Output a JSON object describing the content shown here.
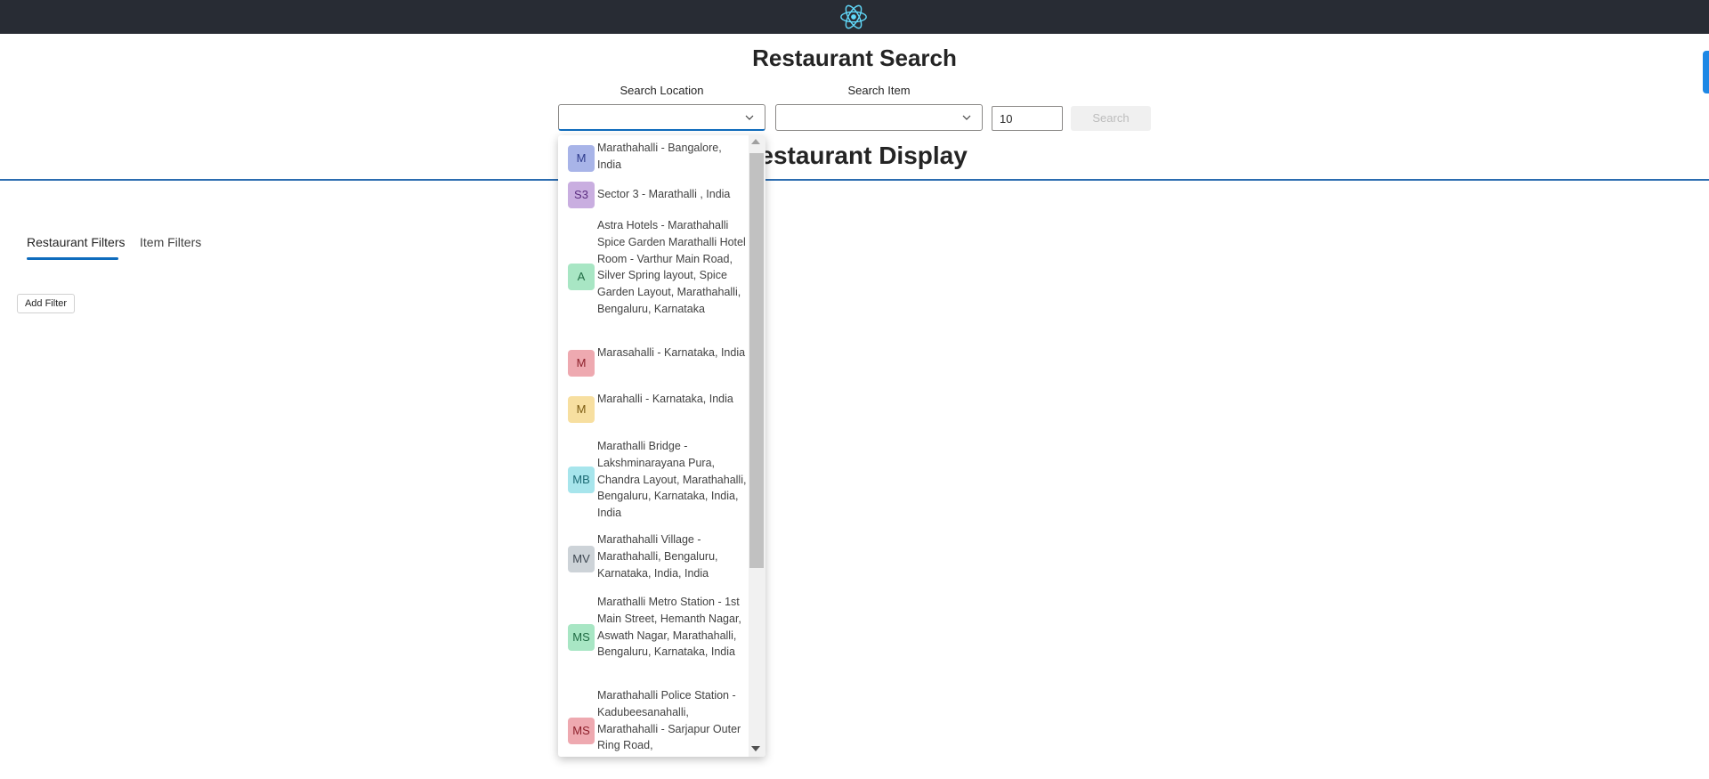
{
  "header": {
    "logo_icon": "react-atom-icon"
  },
  "page": {
    "title": "Restaurant Search",
    "section_title": "Restaurant Display"
  },
  "search": {
    "location_label": "Search Location",
    "location_value": "",
    "item_label": "Search Item",
    "item_value": "",
    "count_value": "10",
    "button_label": "Search"
  },
  "tabs": [
    "Restaurant Filters",
    "Item Filters"
  ],
  "filters": {
    "add_label": "Add Filter"
  },
  "dropdown": {
    "options": [
      {
        "initials": "M",
        "text": "Marathahalli - Bangalore, India",
        "bg": "#a8b4e8",
        "fg": "#2d3a8c"
      },
      {
        "initials": "S3",
        "text": "Sector 3 - Marathalli , India",
        "bg": "#c9aee0",
        "fg": "#5b2d80"
      },
      {
        "initials": "A",
        "text": "Astra Hotels - Marathahalli Spice Garden Marathalli Hotel Room - Varthur Main Road, Silver Spring layout, Spice Garden Layout, Marathahalli, Bengaluru, Karnataka",
        "bg": "#a8e6c4",
        "fg": "#1f6b43"
      },
      {
        "initials": "M",
        "text": "Marasahalli - Karnataka, India",
        "bg": "#eea9b0",
        "fg": "#8c1f2a"
      },
      {
        "initials": "M",
        "text": "Marahalli - Karnataka, India",
        "bg": "#f7dfa0",
        "fg": "#7a5a10"
      },
      {
        "initials": "MB",
        "text": "Marathalli Bridge - Lakshminarayana Pura, Chandra Layout, Marathahalli, Bengaluru, Karnataka, India, India",
        "bg": "#a7e5ec",
        "fg": "#1c6a74"
      },
      {
        "initials": "MV",
        "text": "Marathahalli Village - Marathahalli, Bengaluru, Karnataka, India, India",
        "bg": "#cdd3d8",
        "fg": "#3d4750"
      },
      {
        "initials": "MS",
        "text": "Marathalli Metro Station - 1st Main Street, Hemanth Nagar, Aswath Nagar, Marathahalli, Bengaluru, Karnataka, India",
        "bg": "#a8e6c4",
        "fg": "#1f6b43"
      },
      {
        "initials": "MS",
        "text": "Marathahalli Police Station - Kadubeesanahalli, Marathahalli - Sarjapur Outer Ring Road,",
        "bg": "#eea9b0",
        "fg": "#8c1f2a"
      }
    ]
  }
}
